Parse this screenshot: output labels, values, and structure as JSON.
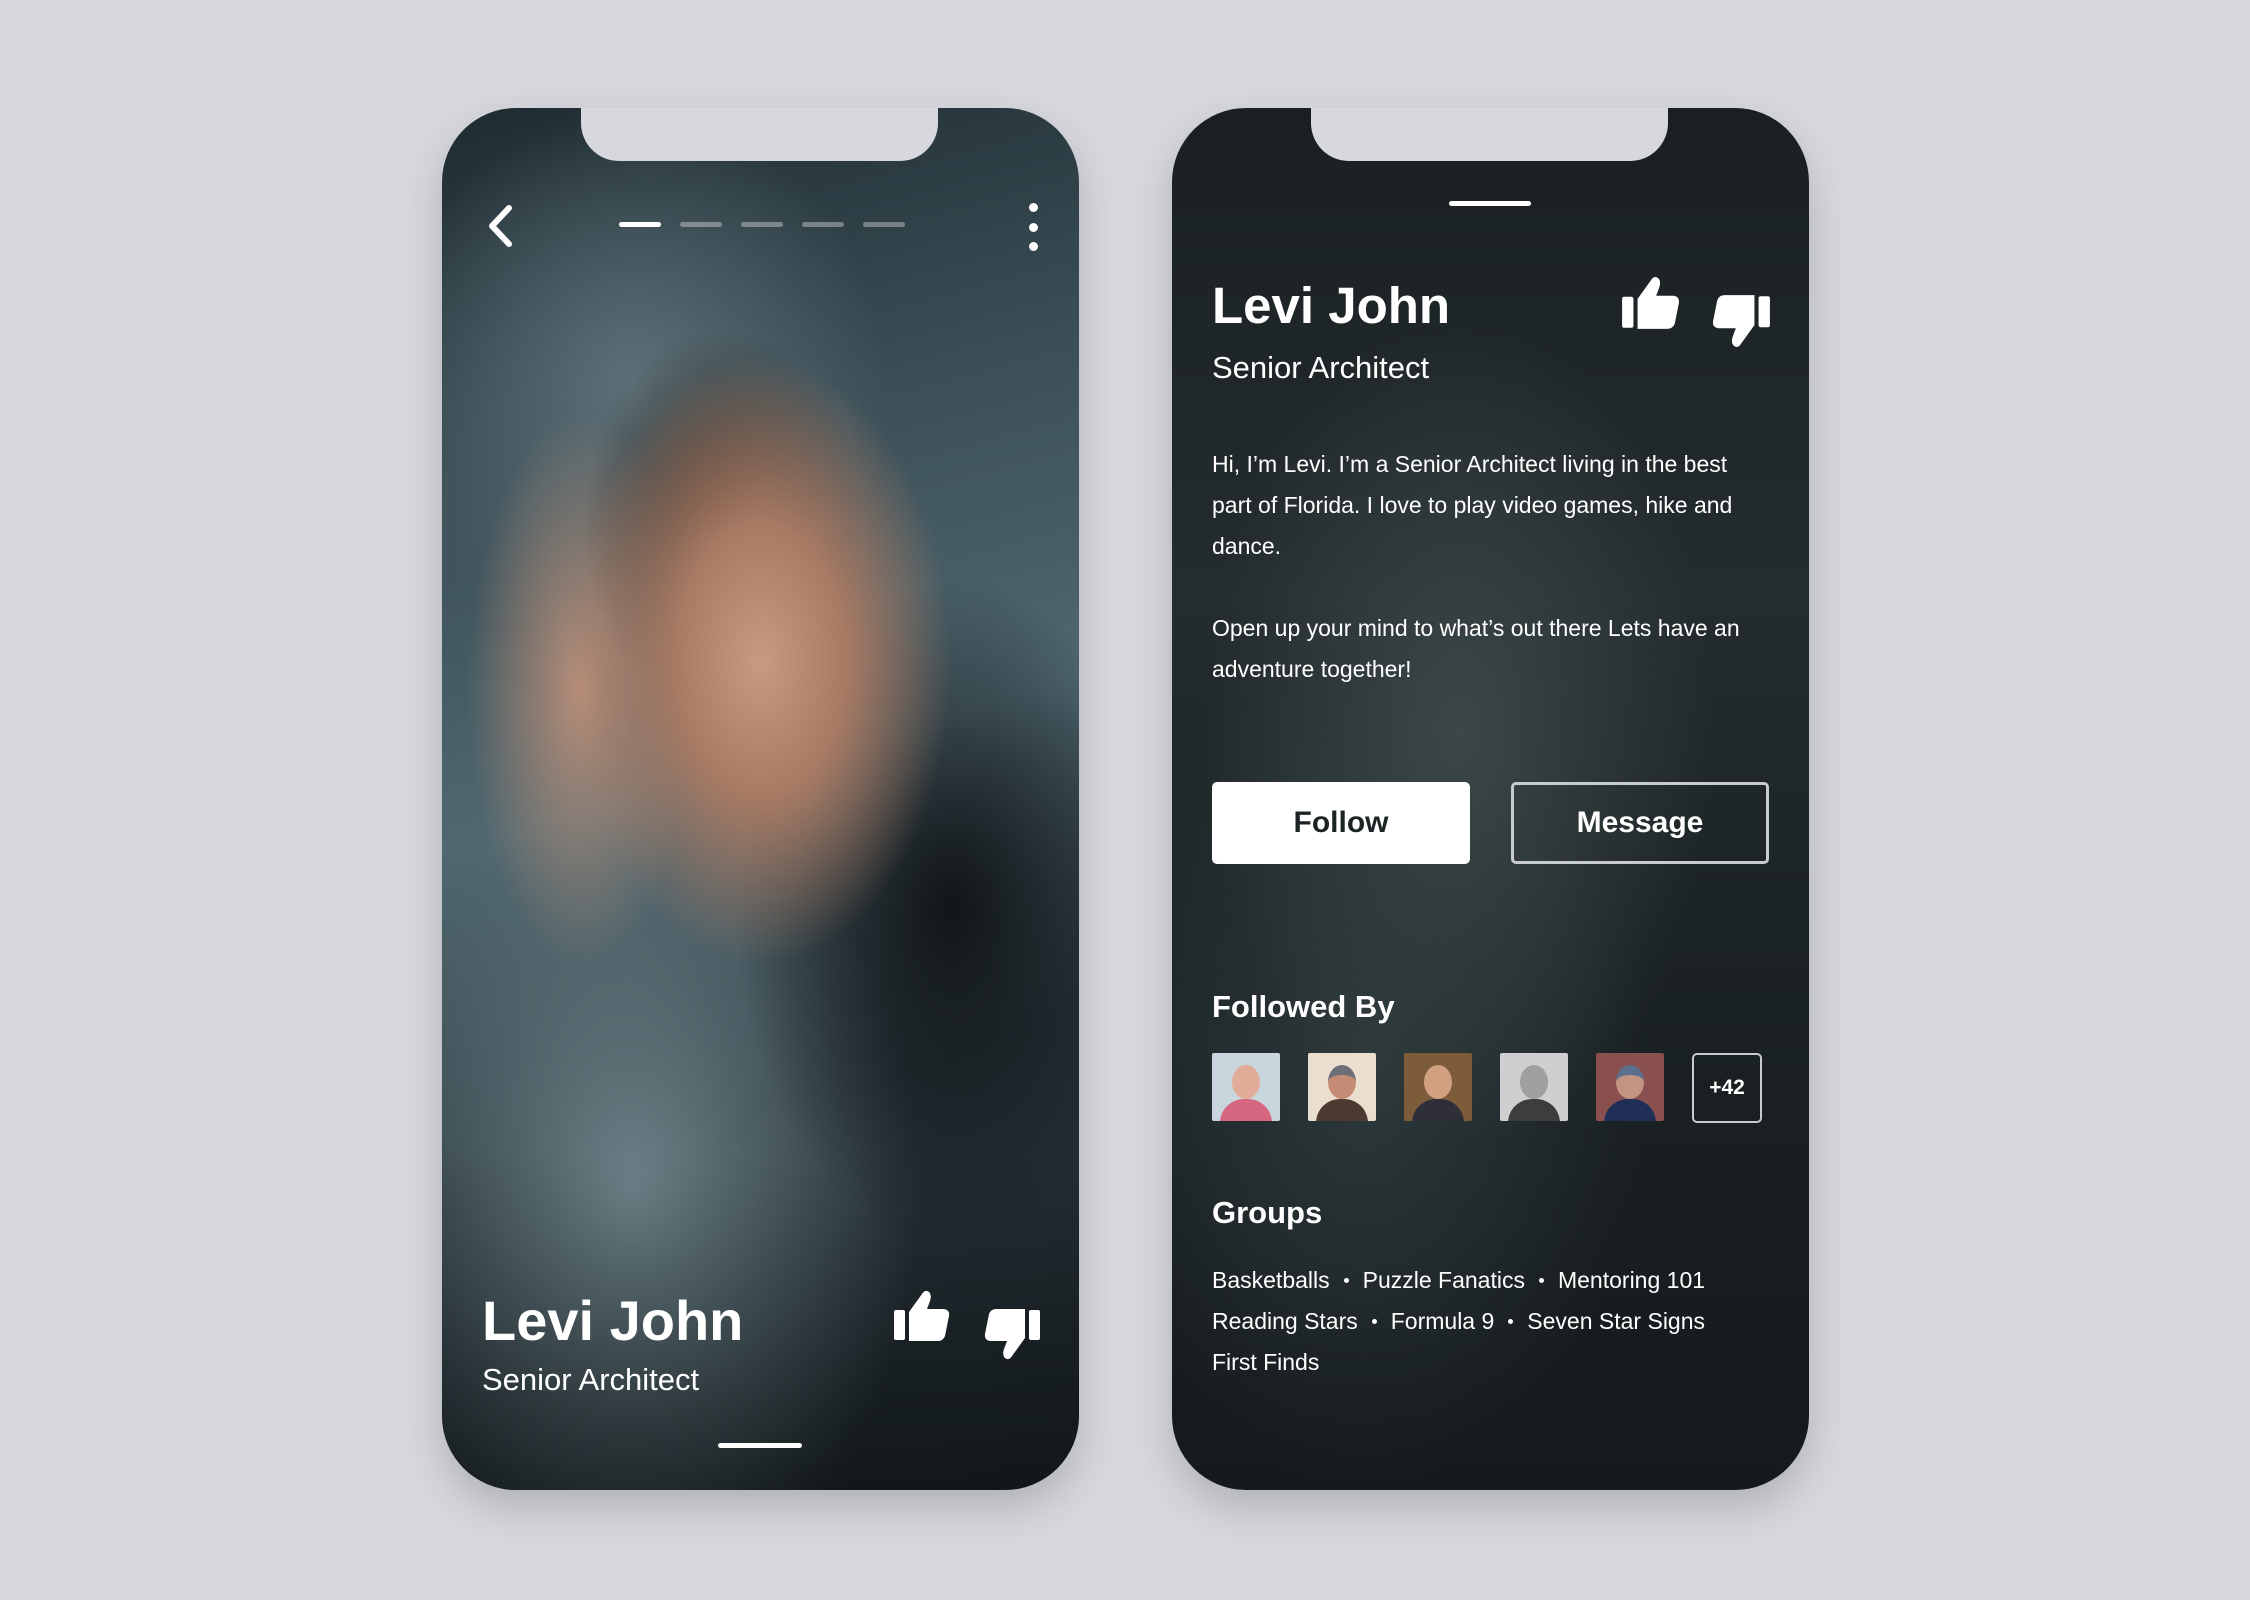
{
  "profile": {
    "name": "Levi John",
    "title": "Senior Architect"
  },
  "left_screen": {
    "photo_slides_total": 5,
    "photo_slide_active": 1,
    "icons": {
      "back": "chevron-left-icon",
      "more": "more-vertical-icon",
      "like": "thumbs-up-icon",
      "dislike": "thumbs-down-icon"
    }
  },
  "right_screen": {
    "bio_paragraphs": [
      "Hi, I’m Levi. I’m a Senior Architect living in the best part of Florida. I love to play video games, hike and dance.",
      "Open up your mind to what’s out there Lets have an adventure together!"
    ],
    "buttons": {
      "follow": "Follow",
      "message": "Message"
    },
    "followed_by": {
      "title": "Followed By",
      "avatar_count_shown": 5,
      "more_label": "+42"
    },
    "groups": {
      "title": "Groups",
      "rows": [
        [
          "Basketballs",
          "Puzzle Fanatics",
          "Mentoring 101"
        ],
        [
          "Reading Stars",
          "Formula 9",
          "Seven Star Signs"
        ],
        [
          "First Finds"
        ]
      ]
    }
  },
  "colors": {
    "background": "#d7d8dd",
    "text": "#ffffff",
    "follow_button_bg": "#ffffff",
    "follow_button_text": "#1d2426",
    "outline": "#c9cccd"
  }
}
